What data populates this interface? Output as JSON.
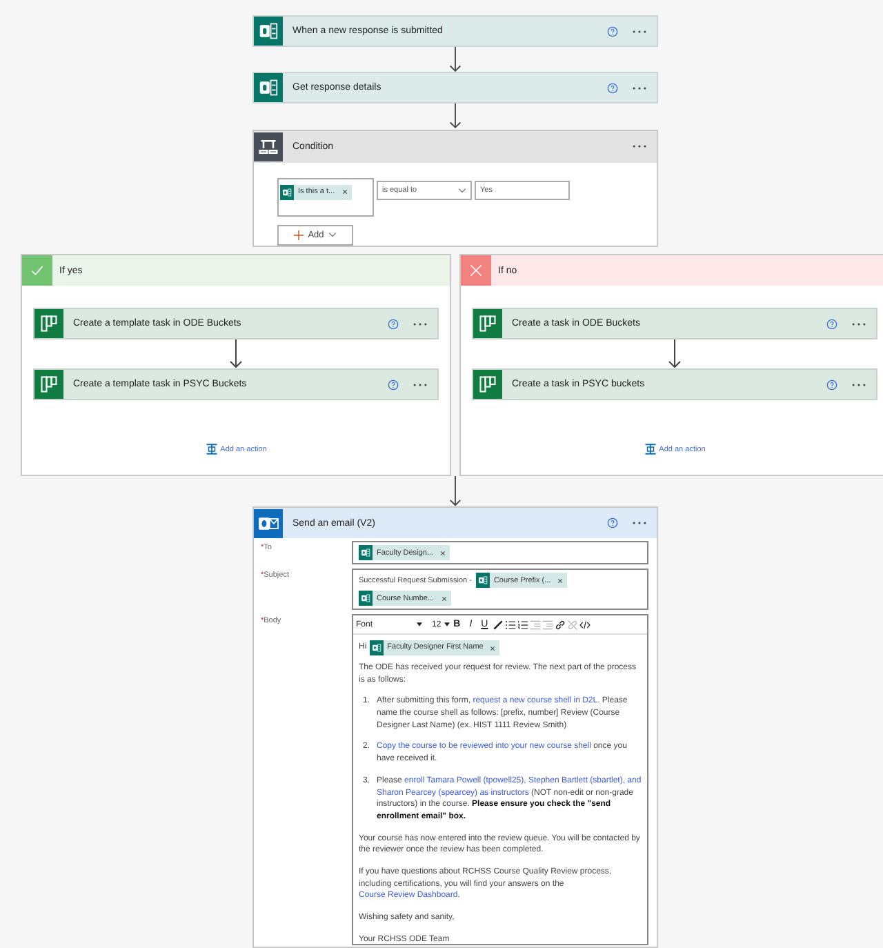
{
  "steps": [
    {
      "kind": "forms",
      "title": "When a new response is submitted"
    },
    {
      "kind": "forms",
      "title": "Get response details"
    }
  ],
  "condition": {
    "title": "Condition",
    "token": "Is this a t...",
    "operator": "is equal to",
    "value": "Yes",
    "add": "Add"
  },
  "branches": [
    {
      "kind": "yes",
      "label": "If yes",
      "actions": [
        {
          "title": "Create a template task in ODE Buckets"
        },
        {
          "title": "Create a template task in PSYC Buckets"
        }
      ],
      "add_action": "Add an action"
    },
    {
      "kind": "no",
      "label": "If no",
      "actions": [
        {
          "title": "Create a task in ODE Buckets"
        },
        {
          "title": "Create a task in PSYC buckets"
        }
      ],
      "add_action": "Add an action"
    }
  ],
  "email": {
    "title": "Send an email (V2)",
    "fields": [
      {
        "mark": "*",
        "label": "To",
        "content": [
          {
            "kind": "token",
            "text": "Faculty Design..."
          }
        ]
      },
      {
        "mark": "*",
        "label": "Subject",
        "content": [
          {
            "kind": "text",
            "text": "Successful Request Submission -"
          },
          {
            "kind": "token",
            "text": "Course Prefix (..."
          },
          {
            "kind": "token",
            "text": "Course Numbe..."
          }
        ]
      }
    ],
    "body": {
      "mark": "*",
      "label": "Body",
      "font": "Font",
      "size": "12",
      "format_buttons": [
        "B",
        "I",
        "U"
      ],
      "greeting": "Hi",
      "greeting_token": "Faculty Designer First Name",
      "blocks": [
        {
          "kind": "paragraph",
          "segments": [
            {
              "kind": "text",
              "text": "The ODE has received your request for review. The next part of the process is as follows:"
            }
          ]
        },
        {
          "kind": "item",
          "number": "1.",
          "segments": [
            {
              "kind": "text",
              "text": "After submitting this form, "
            },
            {
              "kind": "link",
              "text": "request a new course shell in D2L"
            },
            {
              "kind": "text",
              "text": ". Please name the course shell as follows: [prefix, number] Review (Course Designer Last Name) (ex. HIST 1111 Review Smith)"
            }
          ]
        },
        {
          "kind": "item",
          "number": "2.",
          "segments": [
            {
              "kind": "link",
              "text": "Copy the course to be reviewed into your new course shell"
            },
            {
              "kind": "text",
              "text": " once you have received it."
            }
          ]
        },
        {
          "kind": "item",
          "number": "3.",
          "segments": [
            {
              "kind": "text",
              "text": "Please "
            },
            {
              "kind": "link",
              "text": "enroll Tamara Powell (tpowell25),"
            },
            {
              "kind": "link",
              "text": "Stephen Bartlett (sbartlet), and"
            },
            {
              "kind": "link",
              "text": "Sharon Pearcey (spearcey) as instructors"
            },
            {
              "kind": "text",
              "text": " (NOT non-edit or non-grade instructors) in the course. "
            },
            {
              "kind": "bold",
              "text": "Please ensure you check the \"send enrollment email\" box."
            }
          ]
        },
        {
          "kind": "paragraph",
          "segments": [
            {
              "kind": "text",
              "text": "Your course has now entered into the review queue. You will be contacted by the reviewer once the review has been completed."
            }
          ]
        },
        {
          "kind": "paragraph",
          "segments": [
            {
              "kind": "text",
              "text": "If you have questions about RCHSS Course Quality Review process, including certifications, you will find your answers on the "
            },
            {
              "kind": "link",
              "text": "Course Review Dashboard"
            },
            {
              "kind": "text",
              "text": "."
            }
          ]
        },
        {
          "kind": "paragraph",
          "segments": [
            {
              "kind": "text",
              "text": "Wishing safety and  sanity,"
            }
          ]
        },
        {
          "kind": "paragraph",
          "segments": [
            {
              "kind": "text",
              "text": "Your RCHSS ODE Team"
            }
          ]
        }
      ]
    }
  }
}
